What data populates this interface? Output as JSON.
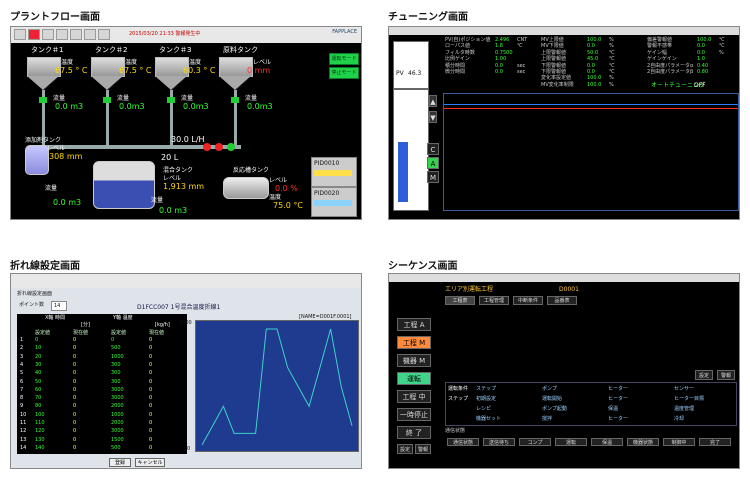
{
  "captions": {
    "plant_flow": "プラントフロー画面",
    "tuning": "チューニング画面",
    "polyline": "折れ線設定画面",
    "sequence": "シーケンス画面"
  },
  "plant": {
    "tanks": [
      {
        "name": "タンク＃1",
        "temp_label": "温度",
        "temp": "67.5 ° C",
        "flow_label": "流量",
        "flow": "0.0 m3"
      },
      {
        "name": "タンク＃2",
        "temp_label": "温度",
        "temp": "67.5 ° C",
        "flow_label": "流量",
        "flow": "0.0m3"
      },
      {
        "name": "タンク＃3",
        "temp_label": "温度",
        "temp": "60.3 ° C",
        "flow_label": "流量",
        "flow": "0.0m3"
      },
      {
        "name": "原料タンク",
        "temp_label": "レベル",
        "temp": "0 mm",
        "flow_label": "流量",
        "flow": "0.0m3"
      }
    ],
    "rate": "30.0 L/H",
    "rate2": "20 L",
    "left_tank": {
      "name": "添加剤タンク",
      "level_label": "レベル",
      "level": "308 mm",
      "flow_label": "流量",
      "flow": "0.0 m3"
    },
    "mix_tank": {
      "name": "混合タンク",
      "level_label": "レベル",
      "level": "1,913 mm",
      "flow_label": "流量",
      "flow": "0.0 m3"
    },
    "right_tank": {
      "name": "反応槽タンク",
      "level_label": "レベル",
      "level": "0.0 %",
      "temp_label": "温度",
      "temp": "75.0 °C"
    },
    "buttons": [
      "運転モード",
      "停止モード"
    ],
    "status_boxes": [
      "PID0010",
      "PID0020"
    ],
    "brand": "FAPPLACE",
    "alarm_text": "2015/03/20 21:33 警報発生中"
  },
  "tuning": {
    "pv_label": "PV",
    "pv_value": "46.3",
    "mode": [
      "C",
      "A",
      "M"
    ],
    "rows_left": [
      {
        "label": "PV(自)ポジション値",
        "value": "2.496",
        "unit": "CNT"
      },
      {
        "label": "ローパス値",
        "value": "1.8",
        "unit": "℃"
      },
      {
        "label": "フィルタ時数",
        "value": "0.7500",
        "unit": ""
      },
      {
        "label": "比例ゲイン",
        "value": "1.00",
        "unit": ""
      },
      {
        "label": "積分時間",
        "value": "0.0",
        "unit": "sec"
      },
      {
        "label": "微分時間",
        "value": "0.0",
        "unit": "sec"
      }
    ],
    "rows_mid": [
      {
        "label": "MV上限値",
        "value": "100.0",
        "unit": "%"
      },
      {
        "label": "MV下限値",
        "value": "0.0",
        "unit": "%"
      },
      {
        "label": "上限警報値",
        "value": "50.0",
        "unit": "℃"
      },
      {
        "label": "上限警報値",
        "value": "45.0",
        "unit": "℃"
      },
      {
        "label": "下限警報値",
        "value": "0.0",
        "unit": "℃"
      },
      {
        "label": "下限警報値",
        "value": "0.0",
        "unit": "℃"
      },
      {
        "label": "変化率設定値",
        "value": "100.0",
        "unit": "%"
      },
      {
        "label": "MV変化率制限",
        "value": "100.0",
        "unit": "%"
      }
    ],
    "rows_right": [
      {
        "label": "偏差警報値",
        "value": "100.0",
        "unit": "℃"
      },
      {
        "label": "警報不感帯",
        "value": "0.0",
        "unit": "℃"
      },
      {
        "label": "ゲイン幅",
        "value": "0.0",
        "unit": "%"
      },
      {
        "label": "ゲインゲイン",
        "value": "1.0",
        "unit": ""
      },
      {
        "label": "2自由度パラメータα",
        "value": "0.40",
        "unit": ""
      },
      {
        "label": "2自由度パラメータβ",
        "value": "0.80",
        "unit": ""
      }
    ],
    "auto_label": "オートチューニング",
    "status": "OFF"
  },
  "polyline": {
    "title": "折れ線設定画面",
    "points_label": "ポイント数",
    "points": "14",
    "chart_title": "D1FCC007 1号混合温度折線1",
    "chart_name": "[NAME=D001F.0001]",
    "col_x": "X軸 時間",
    "col_y": "Y軸 温度",
    "x_unit": "[分]",
    "y_unit": "[kg/h]",
    "sub_cols": [
      "設定値",
      "現在値",
      "設定値",
      "現在値"
    ],
    "rows": [
      [
        1,
        0,
        0,
        0,
        0
      ],
      [
        2,
        10,
        0,
        500,
        0
      ],
      [
        3,
        20,
        0,
        1000,
        0
      ],
      [
        4,
        30,
        0,
        300,
        0
      ],
      [
        5,
        40,
        0,
        300,
        0
      ],
      [
        6,
        50,
        0,
        300,
        0
      ],
      [
        7,
        60,
        0,
        3000,
        0
      ],
      [
        8,
        70,
        0,
        3000,
        0
      ],
      [
        9,
        80,
        0,
        2000,
        0
      ],
      [
        10,
        100,
        0,
        1000,
        0
      ],
      [
        11,
        110,
        0,
        2000,
        0
      ],
      [
        12,
        120,
        0,
        3000,
        0
      ],
      [
        13,
        130,
        0,
        1500,
        0
      ],
      [
        14,
        140,
        0,
        500,
        0
      ]
    ],
    "buttons": [
      "登録",
      "キャンセル"
    ],
    "ymax": "3000",
    "ymin": "0"
  },
  "sequence": {
    "title": "エリア別運転工程",
    "code": "D0001",
    "tabs": [
      "工程表",
      "工程管理",
      "中断条件",
      "品番表"
    ],
    "steps": [
      "工程 A",
      "工程 M",
      "機器 M",
      "運転",
      "工程 中",
      "一時停止",
      "終 了"
    ],
    "bottom_buttons": [
      "設定",
      "警報"
    ],
    "right_buttons": [
      "設定",
      "警報"
    ],
    "row_headers": [
      "運転条件",
      "ステップ"
    ],
    "row1": [
      "ステップ",
      "ポンプ",
      "ヒーター",
      "センサー"
    ],
    "row2": [
      "初期設定",
      "運転開始",
      "ヒーター",
      "ヒーター目標"
    ],
    "row3": [
      "レシピ",
      "ポンプ起動",
      "保温",
      "温度管理"
    ],
    "row4": [
      "機器セット",
      "撹拌",
      "ヒーター",
      "冷却"
    ],
    "legend_label": "通信状態",
    "chips": [
      "通信状態",
      "送信待ち",
      "コンプ",
      "運転",
      "保温",
      "機器状態",
      "制御中",
      "完了"
    ]
  }
}
